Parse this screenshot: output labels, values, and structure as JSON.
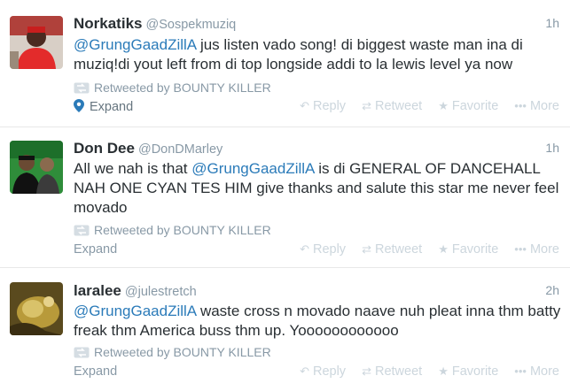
{
  "tweets": [
    {
      "fullname": "Norkatiks",
      "username": "@Sospekmuziq",
      "time": "1h",
      "mention": "@GrungGaadZillA",
      "text_rest": " jus listen vado song! di biggest waste man ina di muziq!di yout left from di top longside addi to la lewis level ya now",
      "retweeted_by": "Retweeted by BOUNTY KILLER",
      "expand": "Expand",
      "expand_icon": "map-pin-icon"
    },
    {
      "fullname": "Don Dee",
      "username": "@DonDMarley",
      "time": "1h",
      "text_pre": "All we nah is that ",
      "mention": "@GrungGaadZillA",
      "text_rest": " is di GENERAL OF DANCEHALL NAH ONE CYAN TES HIM give thanks and salute this star me never feel movado",
      "retweeted_by": "Retweeted by BOUNTY KILLER",
      "expand": "Expand"
    },
    {
      "fullname": "laralee",
      "username": "@julestretch",
      "time": "2h",
      "mention": "@GrungGaadZillA",
      "text_rest": " waste cross n movado naave nuh pleat inna thm batty freak thm America buss thm up. Yoooooooooooo",
      "retweeted_by": "Retweeted by BOUNTY KILLER",
      "expand": "Expand"
    }
  ],
  "actions": {
    "reply": "Reply",
    "retweet": "Retweet",
    "favorite": "Favorite",
    "more": "More",
    "reply_icon": "↶",
    "retweet_icon": "⇄",
    "favorite_icon": "★",
    "more_icon": "•••"
  },
  "colors": {
    "mention": "#2b7bb9",
    "muted": "#8899a6",
    "action": "#ccd6dd"
  }
}
